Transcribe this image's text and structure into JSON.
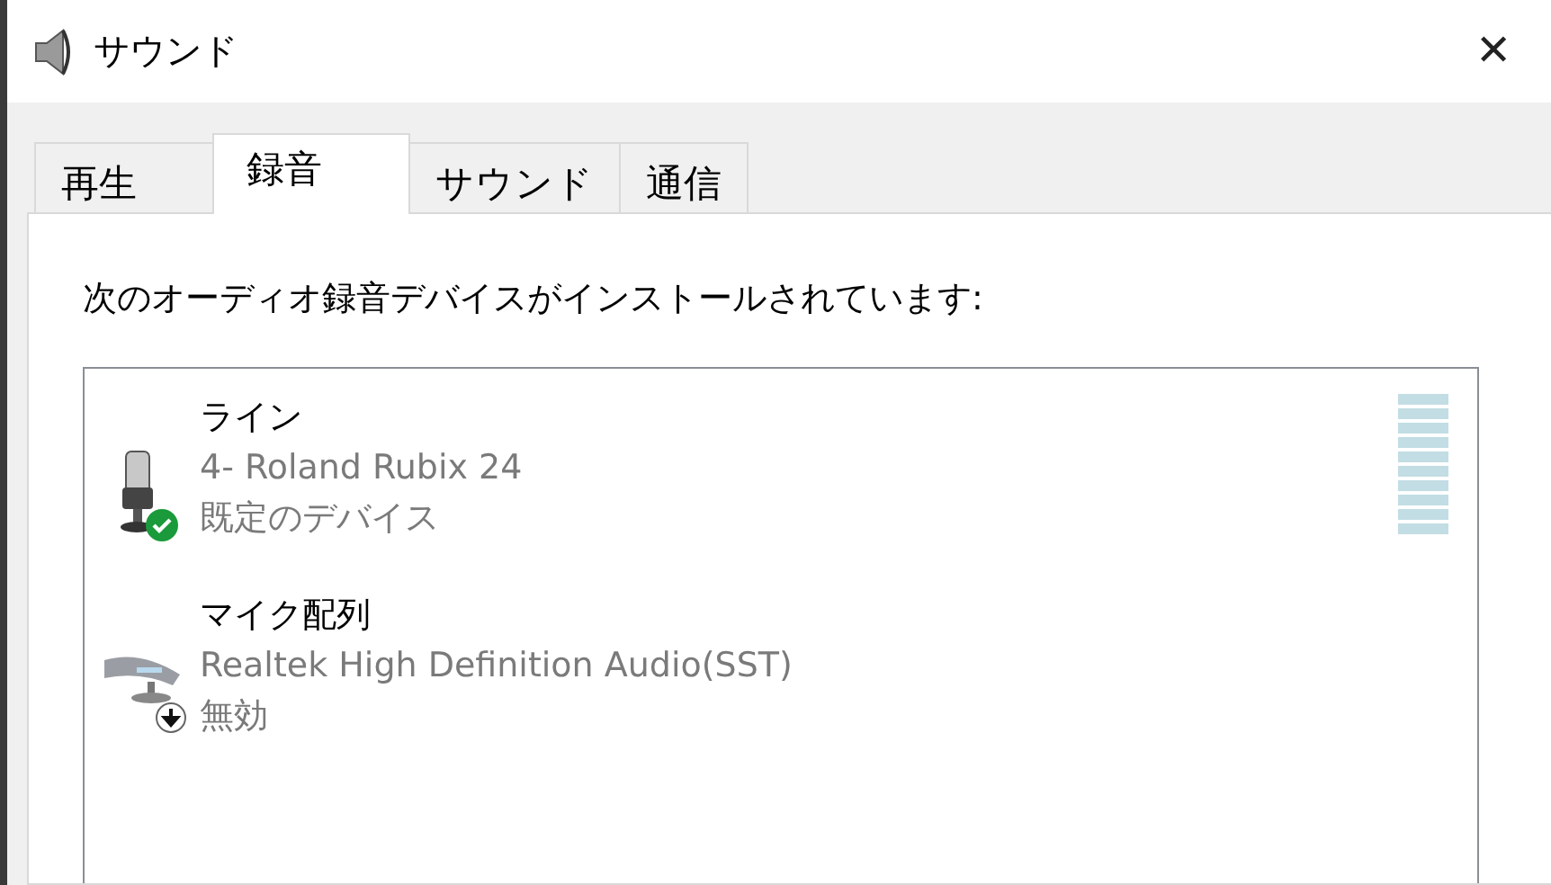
{
  "window": {
    "title": "サウンド",
    "close": "✕"
  },
  "tabs": [
    {
      "label": "再生",
      "selected": false
    },
    {
      "label": "録音",
      "selected": true
    },
    {
      "label": "サウンド",
      "selected": false
    },
    {
      "label": "通信",
      "selected": false
    }
  ],
  "instruction": "次のオーディオ録音デバイスがインストールされています:",
  "devices": [
    {
      "name": "ライン",
      "kind": "line",
      "driver": "4- Roland Rubix 24",
      "status": "既定のデバイス",
      "default": true,
      "disabled": false,
      "meter": true
    },
    {
      "name": "マイク配列",
      "kind": "mic_array",
      "driver": "Realtek High Definition Audio(SST)",
      "status": "無効",
      "default": false,
      "disabled": true,
      "meter": false
    }
  ]
}
